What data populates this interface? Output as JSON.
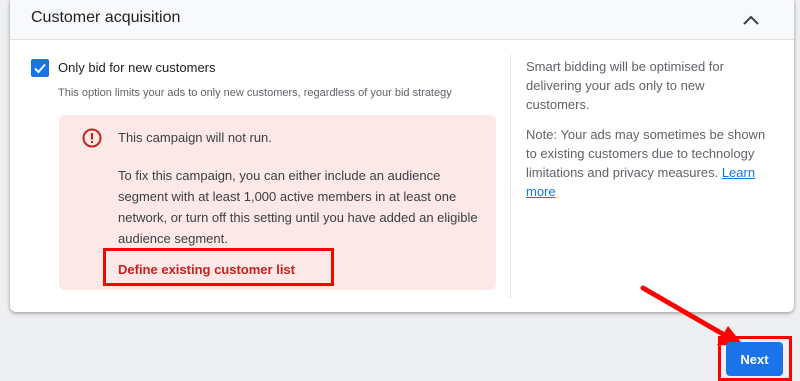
{
  "section": {
    "title": "Customer acquisition"
  },
  "option": {
    "checked": true,
    "label": "Only bid for new customers",
    "description": "This option limits your ads to only new customers, regardless of your bid strategy"
  },
  "error": {
    "title": "This campaign will not run.",
    "body": "To fix this campaign, you can either include an audience segment with at least 1,000 active members in at least one network, or turn off this setting until you have added an eligible audience segment.",
    "link_label": "Define existing customer list"
  },
  "info": {
    "paragraph1": "Smart bidding will be optimised for delivering your ads only to new customers.",
    "paragraph2": "Note: Your ads may sometimes be shown to existing customers due to technology limitations and privacy measures.",
    "learn_more": "Learn more"
  },
  "footer": {
    "next_label": "Next"
  },
  "colors": {
    "primary": "#1a73e8",
    "error_bg": "#fce8e6",
    "error_text": "#c5221f",
    "annotation": "#ff0000"
  },
  "icons": {
    "collapse": "chevron-up-icon",
    "checkbox": "checkmark-icon",
    "error": "error-circle-icon"
  }
}
